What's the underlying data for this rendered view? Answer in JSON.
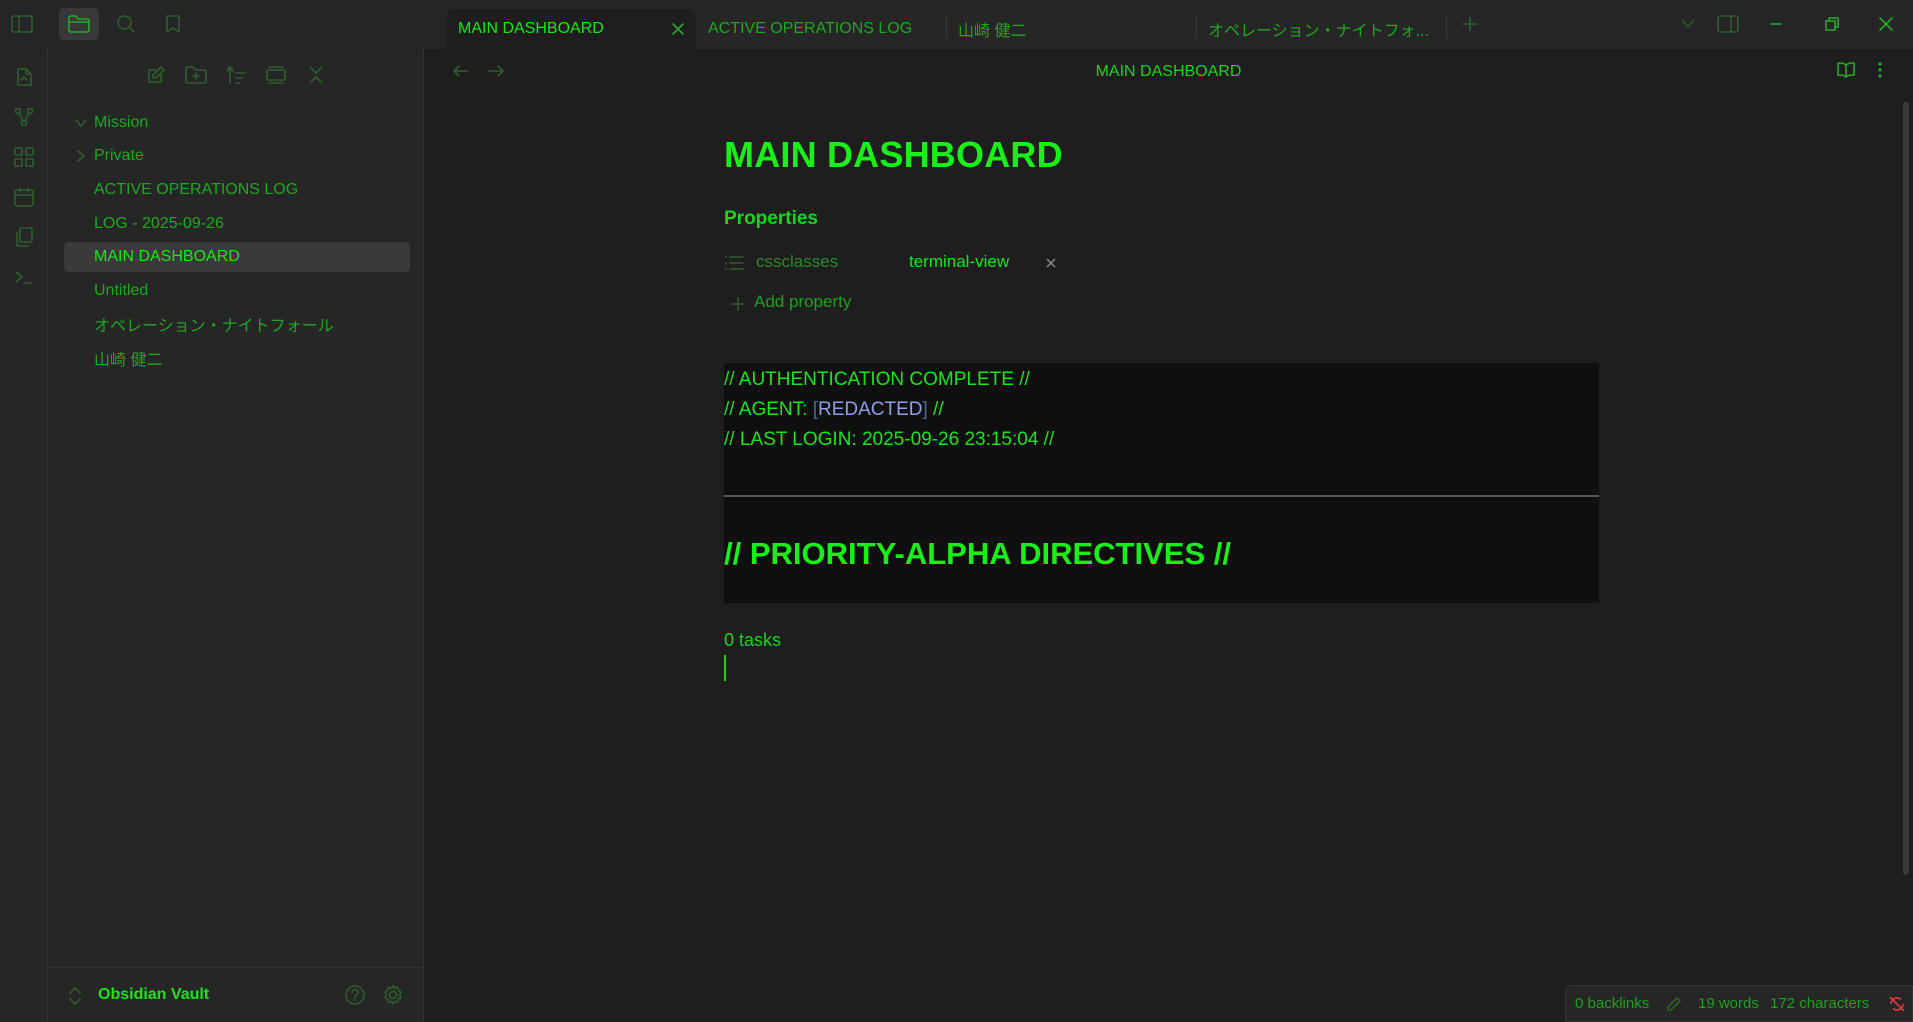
{
  "titlebar": {
    "tabs": [
      {
        "label": "MAIN DASHBOARD",
        "active": true
      },
      {
        "label": "ACTIVE OPERATIONS LOG",
        "active": false
      },
      {
        "label": "山崎 健二",
        "active": false
      },
      {
        "label": "オペレーション・ナイトフォ...",
        "active": false
      }
    ]
  },
  "sidebar": {
    "items": [
      {
        "label": "Mission",
        "type": "folder",
        "expanded": true
      },
      {
        "label": "Private",
        "type": "folder",
        "expanded": false
      },
      {
        "label": "ACTIVE OPERATIONS LOG",
        "type": "file"
      },
      {
        "label": "LOG - 2025-09-26",
        "type": "file"
      },
      {
        "label": "MAIN DASHBOARD",
        "type": "file",
        "active": true
      },
      {
        "label": "Untitled",
        "type": "file"
      },
      {
        "label": "オペレーション・ナイトフォール",
        "type": "file"
      },
      {
        "label": "山崎 健二",
        "type": "file"
      }
    ],
    "vault_name": "Obsidian Vault"
  },
  "main": {
    "view_title": "MAIN DASHBOARD",
    "note_title": "MAIN DASHBOARD",
    "properties_heading": "Properties",
    "property_key": "cssclasses",
    "property_value": "terminal-view",
    "add_property": "Add property",
    "terminal": {
      "line1": "// AUTHENTICATION COMPLETE //",
      "line2_prefix": "// AGENT: ",
      "line2_bracket_open": "[",
      "line2_redacted": "REDACTED",
      "line2_bracket_close": "]",
      "line2_suffix": " //",
      "line3": "// LAST LOGIN: 2025-09-26 23:15:04 //",
      "heading": "// PRIORITY-ALPHA DIRECTIVES //"
    },
    "tasks": "0 tasks"
  },
  "status": {
    "backlinks": "0 backlinks",
    "words": "19 words",
    "characters": "172 characters"
  },
  "colors": {
    "accent": "#19e619",
    "background": "#1e1e1e",
    "panel": "#262626",
    "redacted": "#8f9fe6",
    "sync_error": "#e03a3a"
  }
}
